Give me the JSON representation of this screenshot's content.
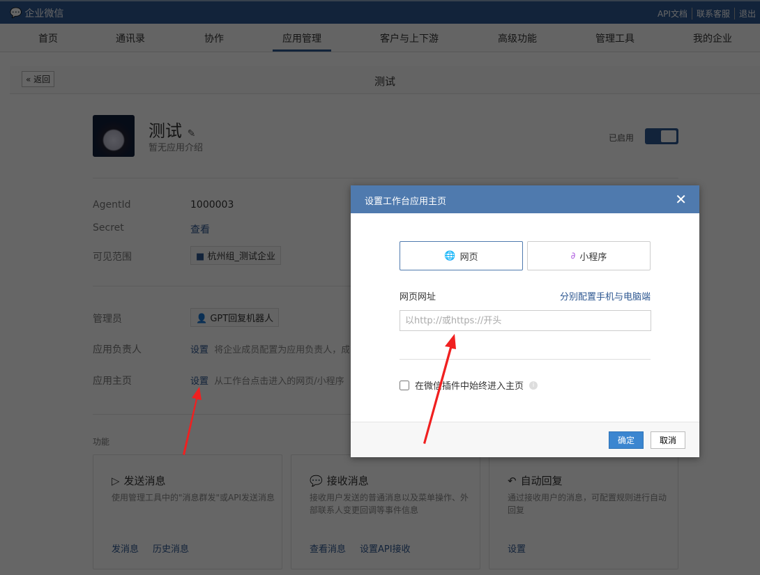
{
  "topbar": {
    "logo": "企业微信",
    "links": [
      "API文档",
      "联系客服",
      "退出"
    ]
  },
  "nav": {
    "items": [
      "首页",
      "通讯录",
      "协作",
      "应用管理",
      "客户与上下游",
      "高级功能",
      "管理工具",
      "我的企业"
    ],
    "active": 3
  },
  "page": {
    "back": "返回",
    "title": "测试"
  },
  "app": {
    "name": "测试",
    "intro": "暂无应用介绍",
    "status": "已启用",
    "enabled": true,
    "agentid_label": "AgentId",
    "agentid": "1000003",
    "secret_label": "Secret",
    "secret_link": "查看",
    "visible_label": "可见范围",
    "visible_value": "杭州组_测试企业",
    "admin_label": "管理员",
    "admin_value": "GPT回复机器人",
    "owner_label": "应用负责人",
    "owner_link": "设置",
    "owner_desc": "将企业成员配置为应用负责人，成",
    "home_label": "应用主页",
    "home_link": "设置",
    "home_desc": "从工作台点击进入的网页/小程序"
  },
  "features": {
    "label": "功能",
    "cards": [
      {
        "title": "发送消息",
        "desc": "使用管理工具中的\"消息群发\"或API发送消息",
        "links": [
          "发消息",
          "历史消息"
        ]
      },
      {
        "title": "接收消息",
        "desc": "接收用户发送的普通消息以及菜单操作、外部联系人变更回调等事件信息",
        "links": [
          "查看消息",
          "设置API接收"
        ]
      },
      {
        "title": "自动回复",
        "desc": "通过接收用户的消息，可配置规则进行自动回复",
        "links": [
          "设置"
        ]
      }
    ]
  },
  "dialog": {
    "title": "设置工作台应用主页",
    "tab_web": "网页",
    "tab_mini": "小程序",
    "url_label": "网页网址",
    "split_link": "分别配置手机与电脑端",
    "url_placeholder": "以http://或https://开头",
    "url_value": "",
    "checkbox_label": "在微信插件中始终进入主页",
    "checked": false,
    "ok": "确定",
    "cancel": "取消"
  }
}
